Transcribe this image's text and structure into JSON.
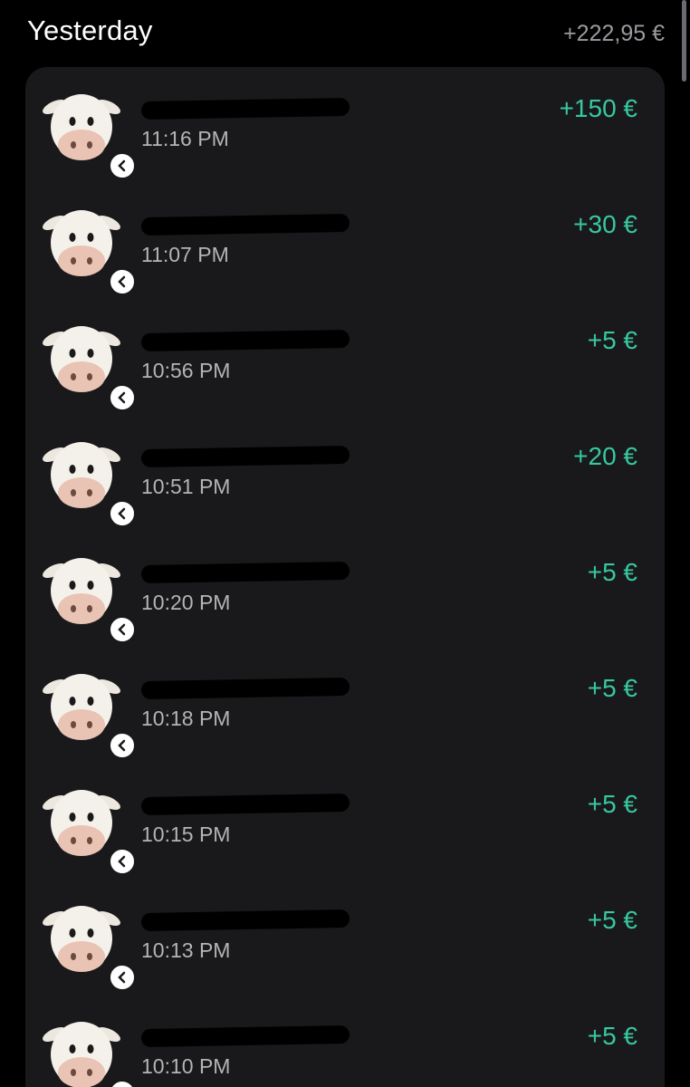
{
  "section": {
    "title": "Yesterday",
    "total": "+222,95 €"
  },
  "transactions": [
    {
      "time": "11:16 PM",
      "amount": "+150 €",
      "avatar": "cow-emoji-icon"
    },
    {
      "time": "11:07 PM",
      "amount": "+30 €",
      "avatar": "cow-emoji-icon"
    },
    {
      "time": "10:56 PM",
      "amount": "+5 €",
      "avatar": "cow-emoji-icon"
    },
    {
      "time": "10:51 PM",
      "amount": "+20 €",
      "avatar": "cow-emoji-icon"
    },
    {
      "time": "10:20 PM",
      "amount": "+5 €",
      "avatar": "cow-emoji-icon"
    },
    {
      "time": "10:18 PM",
      "amount": "+5 €",
      "avatar": "cow-emoji-icon"
    },
    {
      "time": "10:15 PM",
      "amount": "+5 €",
      "avatar": "cow-emoji-icon"
    },
    {
      "time": "10:13 PM",
      "amount": "+5 €",
      "avatar": "cow-emoji-icon"
    },
    {
      "time": "10:10 PM",
      "amount": "+5 €",
      "avatar": "cow-emoji-icon"
    }
  ],
  "colors": {
    "background": "#000000",
    "card": "#19191b",
    "amount_positive": "#37c8a0",
    "secondary_text": "#b4b4b8"
  }
}
